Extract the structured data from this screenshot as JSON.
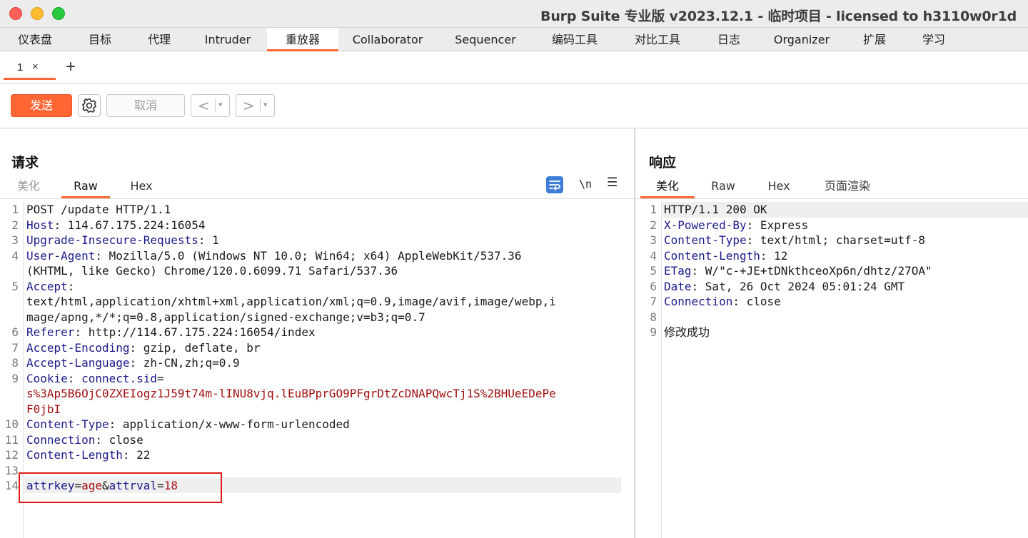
{
  "window": {
    "title": "Burp Suite 专业版  v2023.12.1 - 临时项目 - licensed to h3110w0r1d"
  },
  "main_tabs": [
    {
      "label": "仪表盘"
    },
    {
      "label": "目标"
    },
    {
      "label": "代理"
    },
    {
      "label": "Intruder"
    },
    {
      "label": "重放器",
      "active": true
    },
    {
      "label": "Collaborator"
    },
    {
      "label": "Sequencer"
    },
    {
      "label": "编码工具"
    },
    {
      "label": "对比工具"
    },
    {
      "label": "日志"
    },
    {
      "label": "Organizer"
    },
    {
      "label": "扩展"
    },
    {
      "label": "学习"
    }
  ],
  "sub_tabs": {
    "items": [
      {
        "label": "1",
        "close": "×"
      }
    ],
    "add": "+"
  },
  "toolbar": {
    "send_label": "发送",
    "cancel_label": "取消",
    "back_label": "<",
    "forward_label": ">",
    "dropdown_glyph": "▾"
  },
  "request": {
    "title": "请求",
    "view_tabs": [
      {
        "label": "美化",
        "state": "dim"
      },
      {
        "label": "Raw",
        "state": "active"
      },
      {
        "label": "Hex",
        "state": "normal"
      }
    ],
    "newline_label": "\\n",
    "menu_glyph": "☰",
    "lines": [
      {
        "n": "1",
        "segs": [
          {
            "t": "POST /update HTTP/1.1",
            "c": "p"
          }
        ]
      },
      {
        "n": "2",
        "segs": [
          {
            "t": "Host",
            "c": "k"
          },
          {
            "t": ": 114.67.175.224:16054",
            "c": "p"
          }
        ]
      },
      {
        "n": "3",
        "segs": [
          {
            "t": "Upgrade-Insecure-Requests",
            "c": "k"
          },
          {
            "t": ": 1",
            "c": "p"
          }
        ]
      },
      {
        "n": "4",
        "segs": [
          {
            "t": "User-Agent",
            "c": "k"
          },
          {
            "t": ": Mozilla/5.0 (Windows NT 10.0; Win64; x64) AppleWebKit/537.36",
            "c": "p"
          }
        ]
      },
      {
        "n": "",
        "segs": [
          {
            "t": "(KHTML, like Gecko) Chrome/120.0.6099.71 Safari/537.36",
            "c": "p"
          }
        ]
      },
      {
        "n": "5",
        "segs": [
          {
            "t": "Accept",
            "c": "k"
          },
          {
            "t": ":",
            "c": "p"
          }
        ]
      },
      {
        "n": "",
        "segs": [
          {
            "t": "text/html,application/xhtml+xml,application/xml;q=0.9,image/avif,image/webp,i",
            "c": "p"
          }
        ]
      },
      {
        "n": "",
        "segs": [
          {
            "t": "mage/apng,*/*;q=0.8,application/signed-exchange;v=b3;q=0.7",
            "c": "p"
          }
        ]
      },
      {
        "n": "6",
        "segs": [
          {
            "t": "Referer",
            "c": "k"
          },
          {
            "t": ": http://114.67.175.224:16054/index",
            "c": "p"
          }
        ]
      },
      {
        "n": "7",
        "segs": [
          {
            "t": "Accept-Encoding",
            "c": "k"
          },
          {
            "t": ": gzip, deflate, br",
            "c": "p"
          }
        ]
      },
      {
        "n": "8",
        "segs": [
          {
            "t": "Accept-Language",
            "c": "k"
          },
          {
            "t": ": zh-CN,zh;q=0.9",
            "c": "p"
          }
        ]
      },
      {
        "n": "9",
        "segs": [
          {
            "t": "Cookie",
            "c": "k"
          },
          {
            "t": ": ",
            "c": "p"
          },
          {
            "t": "connect.sid",
            "c": "k"
          },
          {
            "t": "=",
            "c": "p"
          }
        ]
      },
      {
        "n": "",
        "segs": [
          {
            "t": "s%3Ap5B6OjC0ZXEIogz1J59t74m-lINU8vjq.lEuBPprGO9PFgrDtZcDNAPQwcTj1S%2BHUeEDePe",
            "c": "v"
          }
        ]
      },
      {
        "n": "",
        "segs": [
          {
            "t": "F0jbI",
            "c": "v"
          }
        ]
      },
      {
        "n": "10",
        "segs": [
          {
            "t": "Content-Type",
            "c": "k"
          },
          {
            "t": ": application/x-www-form-urlencoded",
            "c": "p"
          }
        ]
      },
      {
        "n": "11",
        "segs": [
          {
            "t": "Connection",
            "c": "k"
          },
          {
            "t": ": close",
            "c": "p"
          }
        ]
      },
      {
        "n": "12",
        "segs": [
          {
            "t": "Content-Length",
            "c": "k"
          },
          {
            "t": ": 22",
            "c": "p"
          }
        ]
      },
      {
        "n": "13",
        "segs": []
      },
      {
        "n": "14",
        "segs": [
          {
            "t": "attrkey",
            "c": "k"
          },
          {
            "t": "=",
            "c": "p"
          },
          {
            "t": "age",
            "c": "v"
          },
          {
            "t": "&",
            "c": "p"
          },
          {
            "t": "attrval",
            "c": "k"
          },
          {
            "t": "=",
            "c": "p"
          },
          {
            "t": "18",
            "c": "v"
          }
        ],
        "highlight": true
      }
    ]
  },
  "response": {
    "title": "响应",
    "view_tabs": [
      {
        "label": "美化",
        "state": "active"
      },
      {
        "label": "Raw",
        "state": "normal"
      },
      {
        "label": "Hex",
        "state": "normal"
      },
      {
        "label": "页面渲染",
        "state": "normal"
      }
    ],
    "lines": [
      {
        "n": "1",
        "segs": [
          {
            "t": "HTTP/1.1 200 OK",
            "c": "p"
          }
        ],
        "highlight": true
      },
      {
        "n": "2",
        "segs": [
          {
            "t": "X-Powered-By",
            "c": "k"
          },
          {
            "t": ": Express",
            "c": "p"
          }
        ]
      },
      {
        "n": "3",
        "segs": [
          {
            "t": "Content-Type",
            "c": "k"
          },
          {
            "t": ": text/html; charset=utf-8",
            "c": "p"
          }
        ]
      },
      {
        "n": "4",
        "segs": [
          {
            "t": "Content-Length",
            "c": "k"
          },
          {
            "t": ": 12",
            "c": "p"
          }
        ]
      },
      {
        "n": "5",
        "segs": [
          {
            "t": "ETag",
            "c": "k"
          },
          {
            "t": ": W/\"c-+JE+tDNkthceoXp6n/dhtz/27OA\"",
            "c": "p"
          }
        ]
      },
      {
        "n": "6",
        "segs": [
          {
            "t": "Date",
            "c": "k"
          },
          {
            "t": ": Sat, 26 Oct 2024 05:01:24 GMT",
            "c": "p"
          }
        ]
      },
      {
        "n": "7",
        "segs": [
          {
            "t": "Connection",
            "c": "k"
          },
          {
            "t": ": close",
            "c": "p"
          }
        ]
      },
      {
        "n": "8",
        "segs": []
      },
      {
        "n": "9",
        "segs": [
          {
            "t": "修改成功",
            "c": "p"
          }
        ]
      }
    ]
  },
  "colors": {
    "accent": "#ff6633",
    "header_key": "#1a1a8c",
    "value_red": "#a01010",
    "highlight_box": "#e21b1b"
  }
}
